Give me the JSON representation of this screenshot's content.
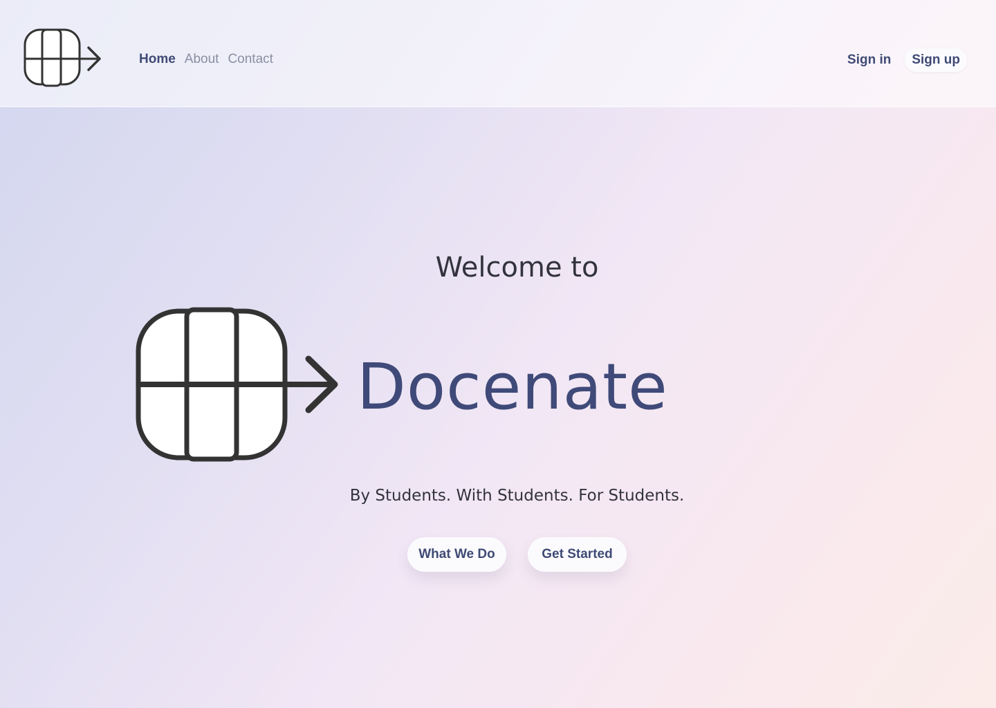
{
  "header": {
    "logo_icon": "docenate-grid-arrow-icon",
    "nav": [
      {
        "label": "Home",
        "active": true
      },
      {
        "label": "About",
        "active": false
      },
      {
        "label": "Contact",
        "active": false
      }
    ],
    "signin_label": "Sign in",
    "signup_label": "Sign up"
  },
  "hero": {
    "welcome": "Welcome to",
    "brand": "Docenate",
    "tagline": "By Students. With Students. For Students.",
    "buttons": {
      "what_we_do": "What We Do",
      "get_started": "Get Started"
    }
  },
  "colors": {
    "brand": "#3f4a79",
    "text_dark": "#33333d",
    "nav_inactive": "#8a8ea3",
    "icon_stroke": "#333333"
  }
}
